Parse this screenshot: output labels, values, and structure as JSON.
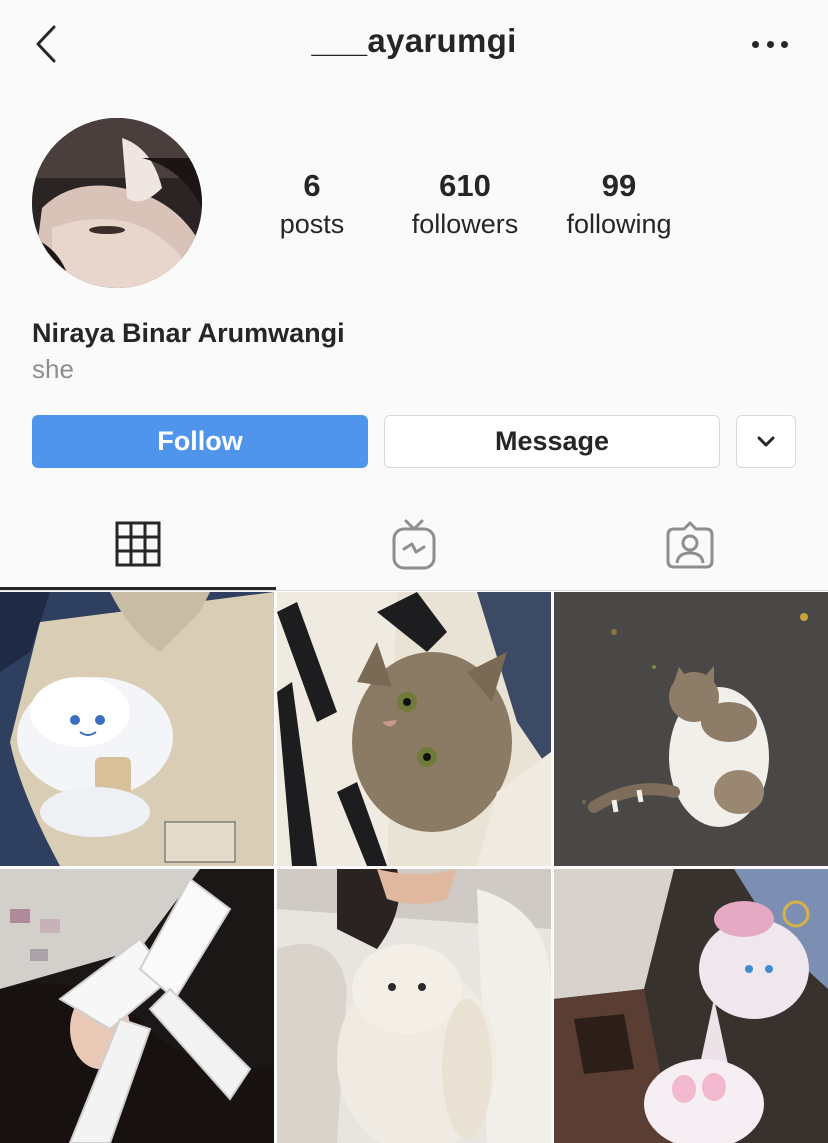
{
  "header": {
    "username": "___ayarumgi",
    "back_icon": "chevron-left-icon",
    "more_icon": "more-horizontal-icon"
  },
  "profile": {
    "full_name": "Niraya Binar Arumwangi",
    "pronoun": "she",
    "stats": {
      "posts": {
        "value": "6",
        "label": "posts"
      },
      "followers": {
        "value": "610",
        "label": "followers"
      },
      "following": {
        "value": "99",
        "label": "following"
      }
    }
  },
  "actions": {
    "follow_label": "Follow",
    "message_label": "Message",
    "more_icon": "chevron-down-icon"
  },
  "tabs": [
    {
      "icon": "grid-icon",
      "active": true
    },
    {
      "icon": "igtv-icon",
      "active": false
    },
    {
      "icon": "tagged-icon",
      "active": false
    }
  ],
  "posts": [
    {
      "subject": "plush-on-bag"
    },
    {
      "subject": "tabby-kitten"
    },
    {
      "subject": "cat-on-asphalt"
    },
    {
      "subject": "lace-hair-bow"
    },
    {
      "subject": "bunny-plush-selfie"
    },
    {
      "subject": "plush-outdoors"
    }
  ],
  "colors": {
    "follow_button": "#4f95ec",
    "text": "#262626",
    "muted": "#8e8e8e",
    "border": "#dbdbdb",
    "background": "#fafafa"
  }
}
